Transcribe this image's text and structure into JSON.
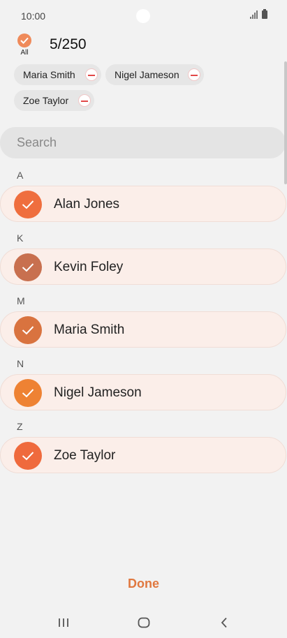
{
  "status_bar": {
    "time": "10:00"
  },
  "header": {
    "select_all_label": "All",
    "counter": "5/250"
  },
  "chips": [
    {
      "label": "Maria Smith"
    },
    {
      "label": "Nigel Jameson"
    },
    {
      "label": "Zoe Taylor"
    }
  ],
  "search": {
    "placeholder": "Search"
  },
  "sections": [
    {
      "letter": "A",
      "contact": {
        "name": "Alan Jones",
        "avatar_color": "#ef6e3e",
        "checked": true
      }
    },
    {
      "letter": "K",
      "contact": {
        "name": "Kevin Foley",
        "avatar_color": "#c8704f",
        "checked": true
      }
    },
    {
      "letter": "M",
      "contact": {
        "name": "Maria Smith",
        "avatar_color": "#d9733f",
        "checked": true
      }
    },
    {
      "letter": "N",
      "contact": {
        "name": "Nigel Jameson",
        "avatar_color": "#ee8233",
        "checked": true
      }
    },
    {
      "letter": "Z",
      "contact": {
        "name": "Zoe Taylor",
        "avatar_color": "#ef6a3d",
        "checked": true
      }
    }
  ],
  "footer": {
    "done_label": "Done"
  },
  "colors": {
    "accent": "#e0783f",
    "row_bg": "#fbeee9",
    "chip_bg": "#e6e6e6",
    "remove_red": "#e24848"
  },
  "icons": {
    "select_all": "check-circle-icon",
    "remove": "minus-circle-icon",
    "nav": [
      "recent-apps-icon",
      "home-icon",
      "back-icon"
    ]
  }
}
